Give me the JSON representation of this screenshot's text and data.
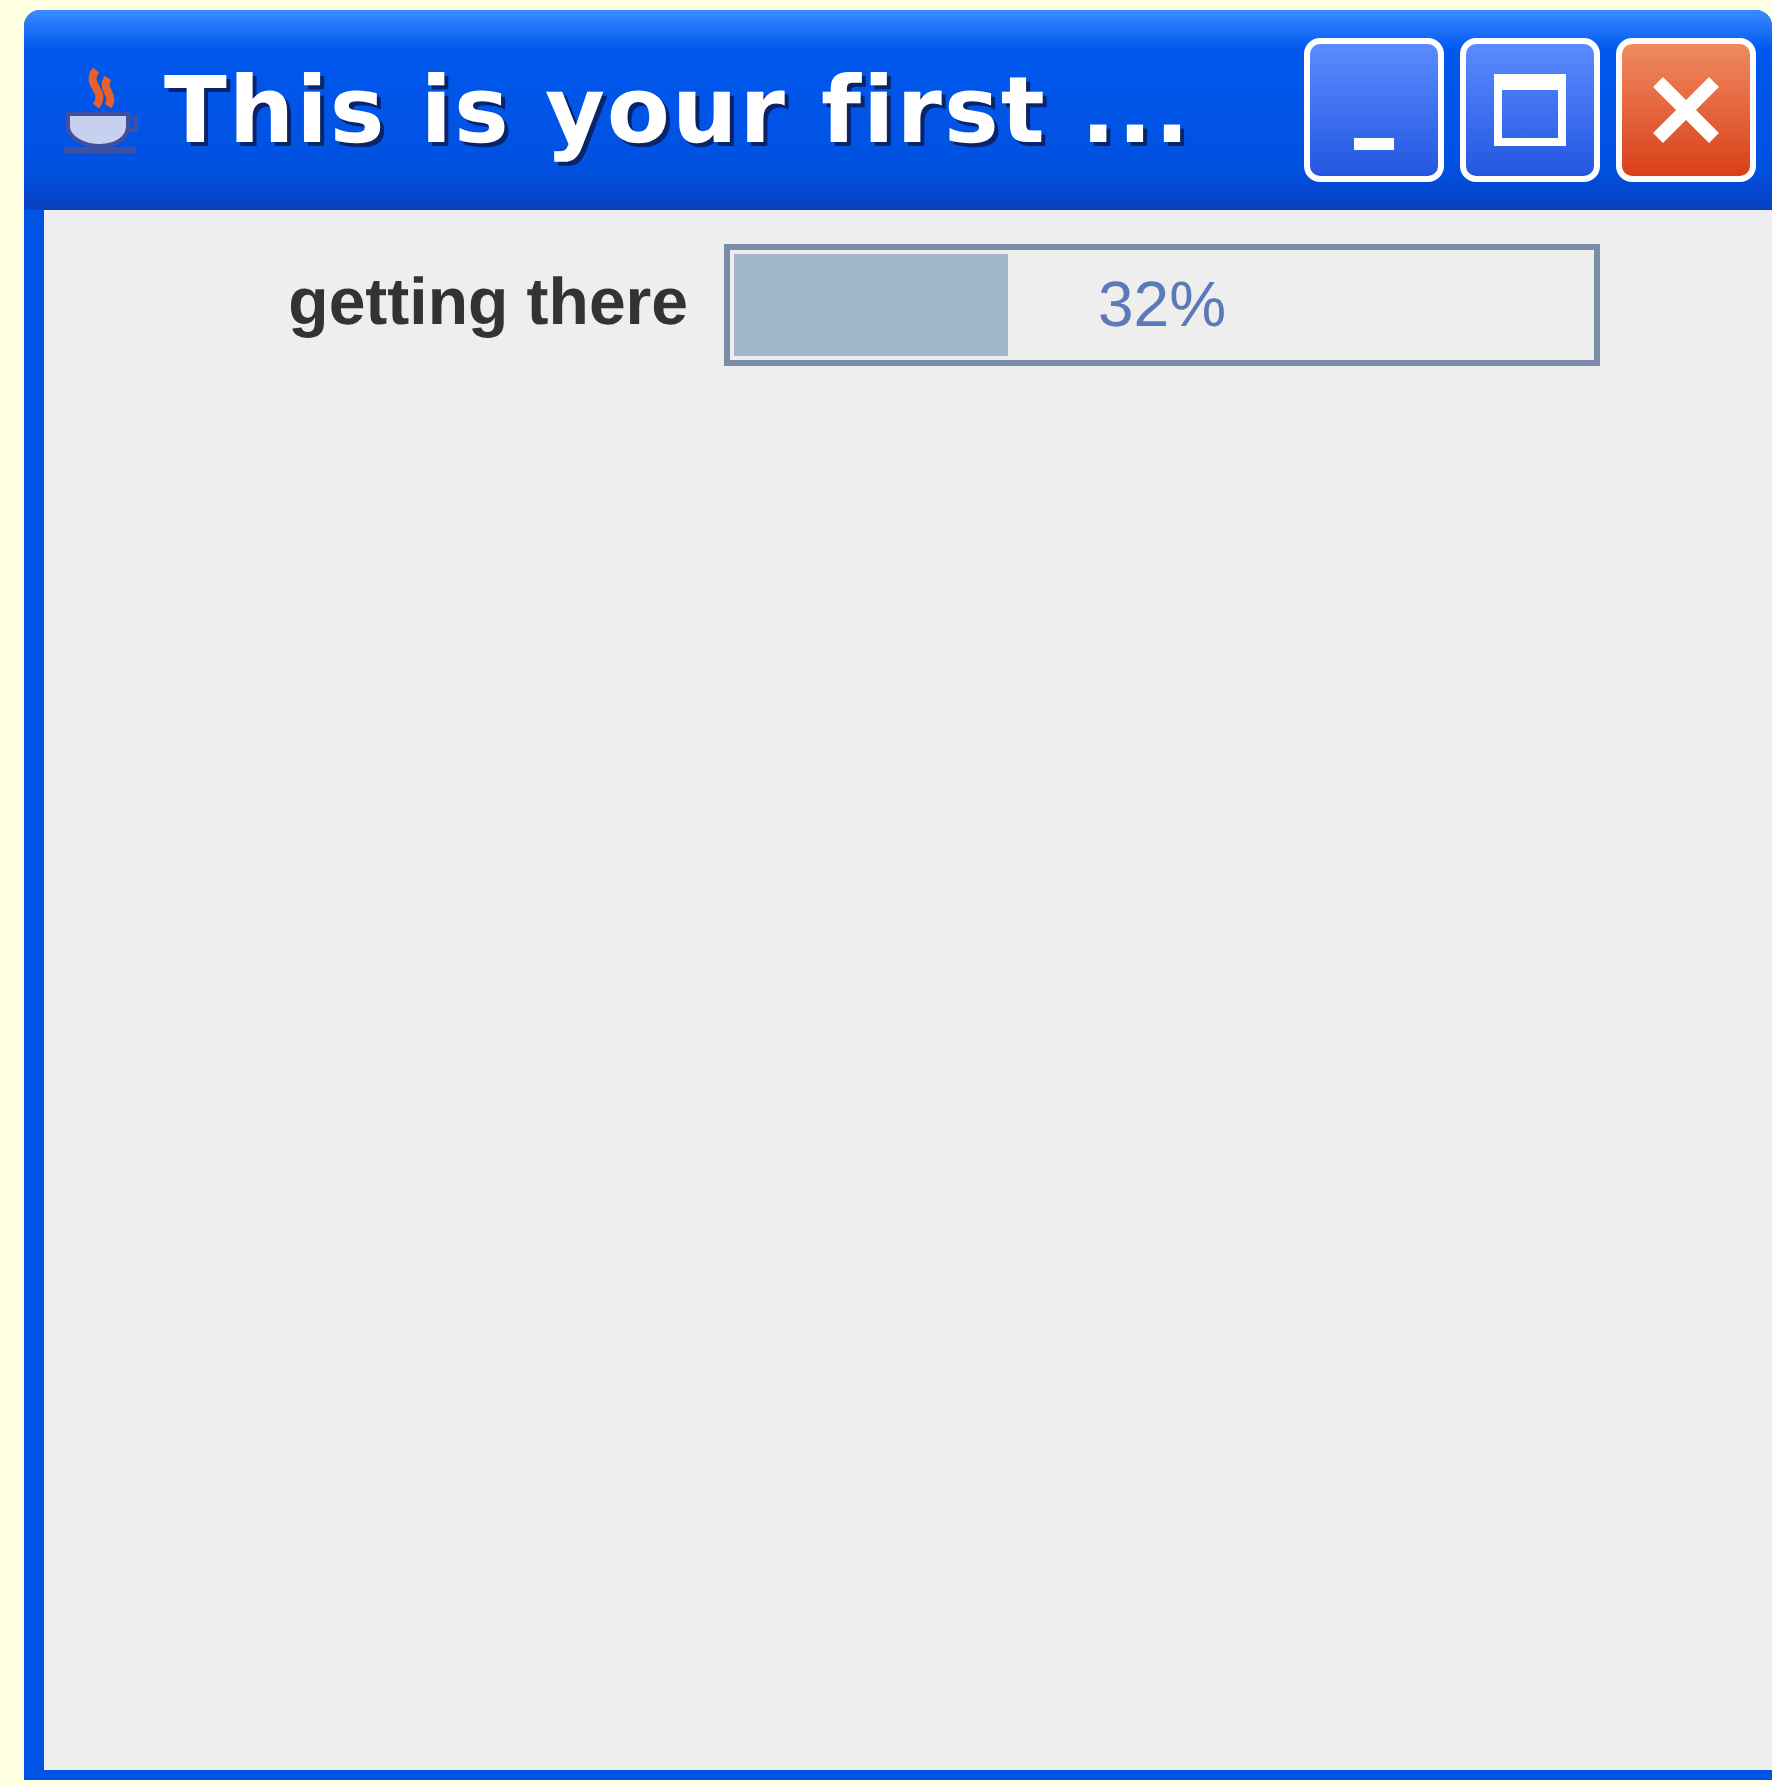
{
  "window": {
    "title": "This is your first ..."
  },
  "progress": {
    "label": "getting there",
    "level": 0.32,
    "reading": "32%"
  }
}
